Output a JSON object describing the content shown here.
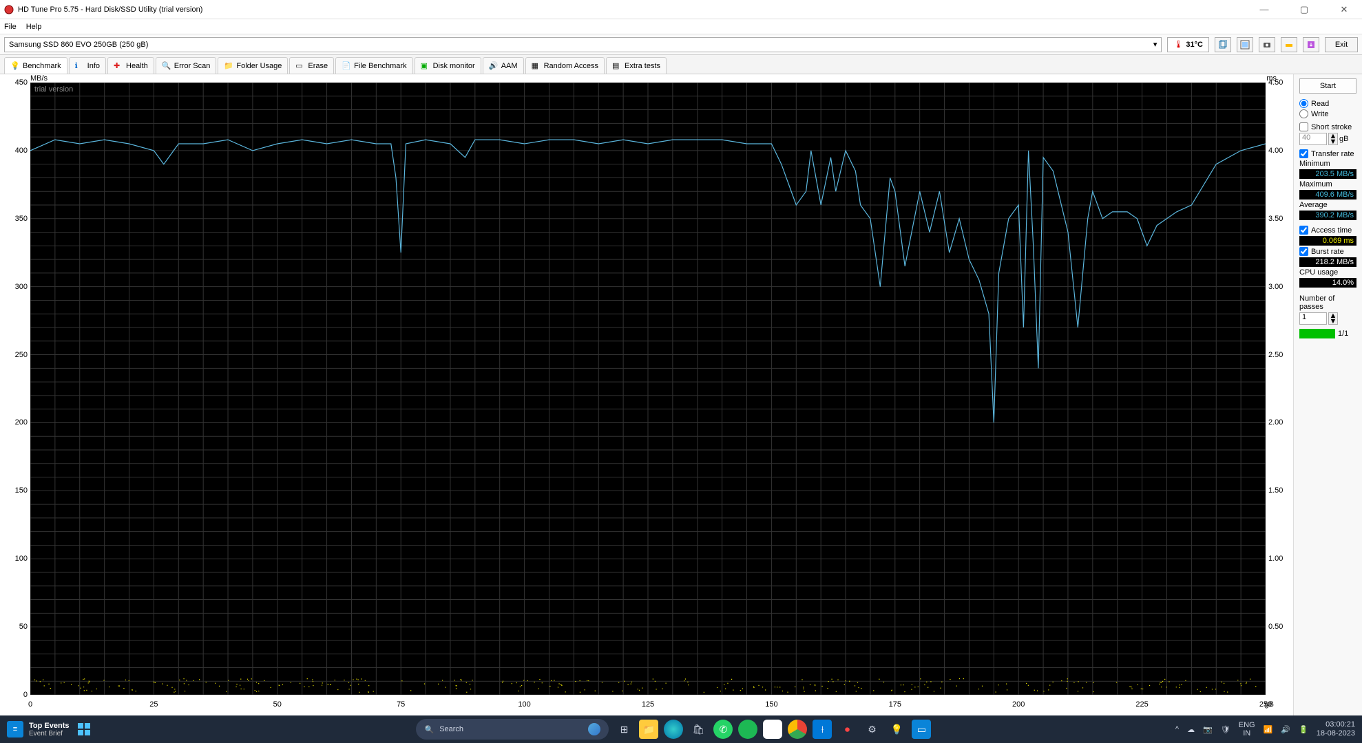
{
  "window": {
    "title": "HD Tune Pro 5.75 - Hard Disk/SSD Utility (trial version)",
    "min_tip": "Minimize",
    "max_tip": "Maximize",
    "close_tip": "Close"
  },
  "menubar": {
    "file": "File",
    "help": "Help"
  },
  "drive": {
    "selected": "Samsung SSD 860 EVO 250GB (250 gB)",
    "temperature": "31°C",
    "exit": "Exit"
  },
  "tabs": {
    "benchmark": "Benchmark",
    "info": "Info",
    "health": "Health",
    "error_scan": "Error Scan",
    "folder_usage": "Folder Usage",
    "erase": "Erase",
    "file_benchmark": "File Benchmark",
    "disk_monitor": "Disk monitor",
    "aam": "AAM",
    "random_access": "Random Access",
    "extra_tests": "Extra tests"
  },
  "sidepanel": {
    "start": "Start",
    "read": "Read",
    "write": "Write",
    "short_stroke": "Short stroke",
    "short_stroke_val": "40",
    "short_stroke_unit": "gB",
    "transfer_rate": "Transfer rate",
    "minimum": "Minimum",
    "minimum_val": "203.5 MB/s",
    "maximum": "Maximum",
    "maximum_val": "409.6 MB/s",
    "average": "Average",
    "average_val": "390.2 MB/s",
    "access_time": "Access time",
    "access_time_val": "0.069 ms",
    "burst_rate": "Burst rate",
    "burst_rate_val": "218.2 MB/s",
    "cpu_usage": "CPU usage",
    "cpu_usage_val": "14.0%",
    "passes": "Number of passes",
    "passes_val": "1",
    "progress": "1/1"
  },
  "chart_data": {
    "type": "line",
    "overlay_text": "trial version",
    "y_left_label": "MB/s",
    "y_right_label": "ms",
    "x_unit": "gB",
    "xlim": [
      0,
      250
    ],
    "y_left_lim": [
      0,
      450
    ],
    "y_right_lim": [
      0,
      4.5
    ],
    "y_left_ticks": [
      0,
      50,
      100,
      150,
      200,
      250,
      300,
      350,
      400,
      450
    ],
    "y_right_ticks": [
      0.5,
      1.0,
      1.5,
      2.0,
      2.5,
      3.0,
      3.5,
      4.0,
      4.5
    ],
    "x_ticks": [
      0,
      25,
      50,
      75,
      100,
      125,
      150,
      175,
      200,
      225,
      250
    ],
    "series": [
      {
        "name": "Transfer rate (MB/s)",
        "axis": "left",
        "kind": "line",
        "color": "#5bb6dd",
        "x": [
          0,
          5,
          10,
          15,
          20,
          25,
          27,
          30,
          35,
          40,
          45,
          50,
          55,
          60,
          65,
          70,
          73,
          74,
          75,
          76,
          80,
          85,
          88,
          90,
          95,
          100,
          105,
          110,
          115,
          120,
          125,
          130,
          135,
          140,
          145,
          150,
          152,
          155,
          157,
          158,
          160,
          162,
          163,
          165,
          167,
          168,
          170,
          172,
          174,
          175,
          177,
          180,
          182,
          184,
          186,
          188,
          190,
          192,
          194,
          195,
          196,
          198,
          200,
          201,
          202,
          203,
          204,
          205,
          207,
          210,
          212,
          214,
          215,
          217,
          219,
          220,
          222,
          224,
          226,
          228,
          230,
          232,
          235,
          240,
          245,
          250
        ],
        "y": [
          400,
          408,
          405,
          408,
          405,
          400,
          390,
          405,
          405,
          408,
          400,
          405,
          408,
          405,
          408,
          405,
          405,
          380,
          325,
          405,
          408,
          405,
          395,
          408,
          408,
          405,
          408,
          408,
          405,
          408,
          405,
          408,
          408,
          408,
          405,
          405,
          390,
          360,
          370,
          400,
          360,
          395,
          370,
          400,
          385,
          360,
          350,
          300,
          380,
          370,
          315,
          370,
          340,
          370,
          325,
          350,
          320,
          305,
          280,
          200,
          310,
          350,
          360,
          270,
          400,
          330,
          240,
          395,
          385,
          340,
          270,
          350,
          370,
          350,
          355,
          355,
          355,
          350,
          330,
          345,
          350,
          355,
          360,
          390,
          400,
          405
        ]
      },
      {
        "name": "Access time (ms)",
        "axis": "right",
        "kind": "scatter",
        "color": "#e8e000",
        "y_center": 0.069,
        "y_spread": 0.05
      }
    ]
  },
  "taskbar": {
    "widget_title": "Top Events",
    "widget_sub": "Event Brief",
    "search_placeholder": "Search",
    "lang1": "ENG",
    "lang2": "IN",
    "time": "03:00:21",
    "date": "18-08-2023"
  }
}
